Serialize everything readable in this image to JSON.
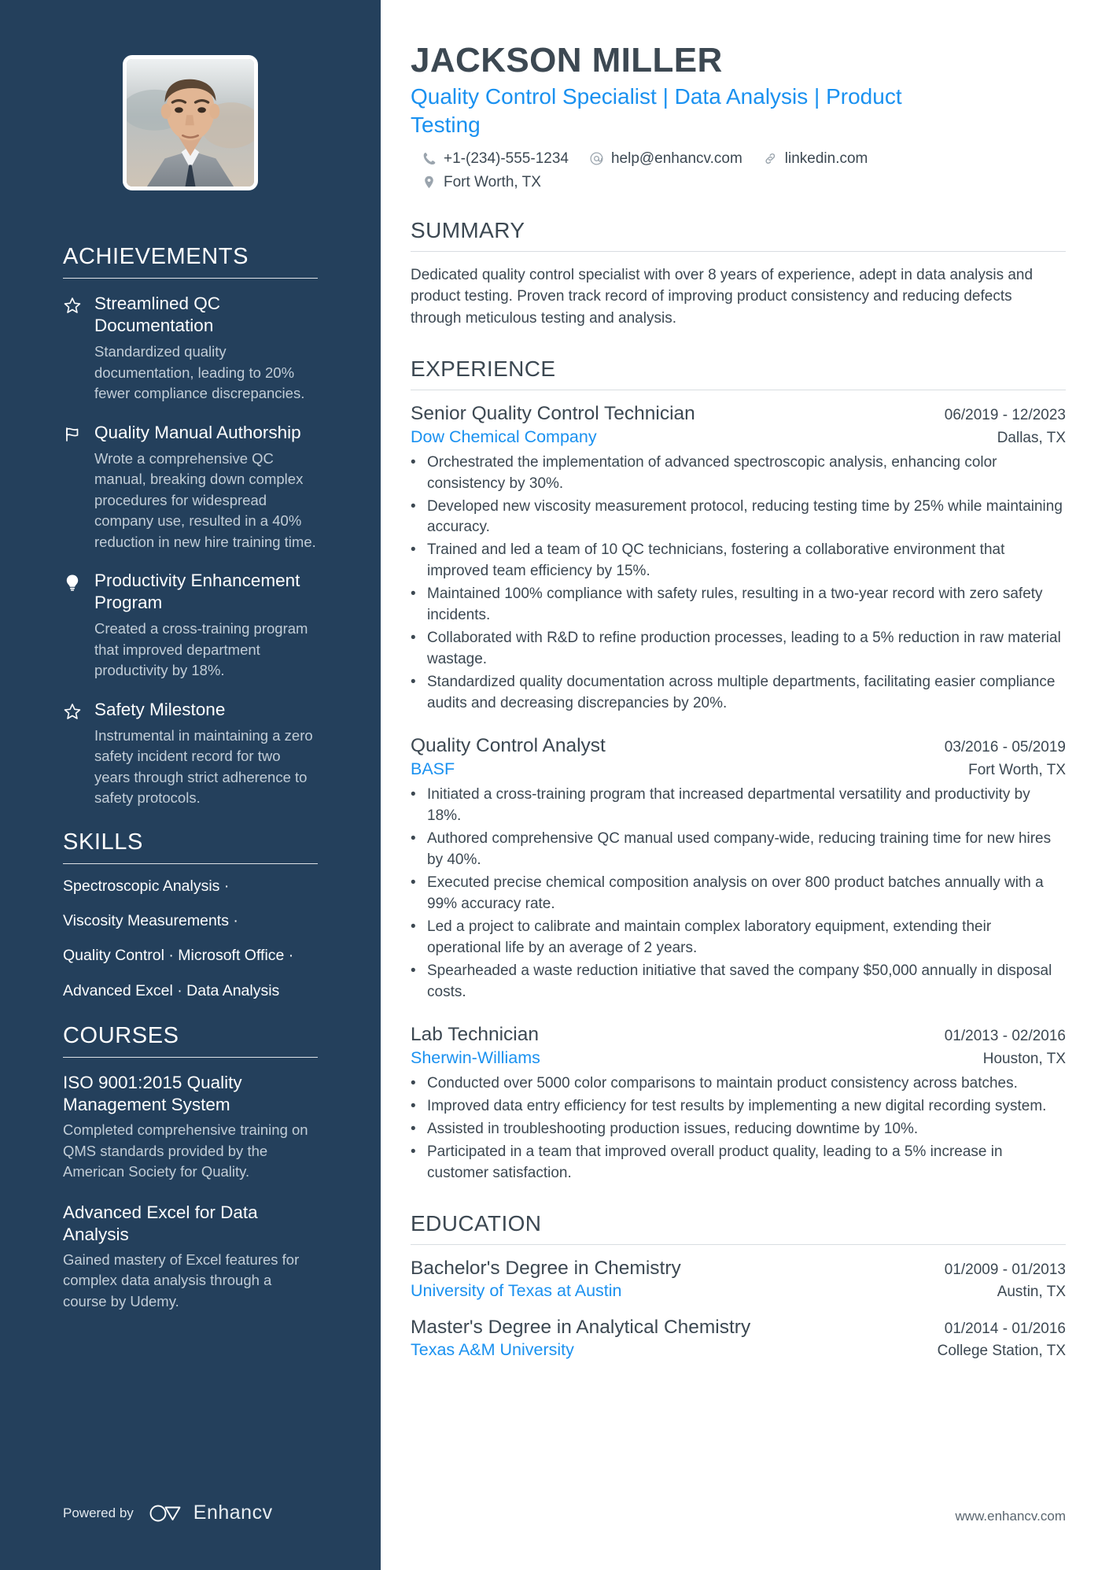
{
  "header": {
    "name": "JACKSON MILLER",
    "headline": "Quality Control Specialist | Data Analysis | Product Testing",
    "contacts": [
      {
        "icon": "phone-icon",
        "text": "+1-(234)-555-1234"
      },
      {
        "icon": "email-icon",
        "text": "help@enhancv.com"
      },
      {
        "icon": "link-icon",
        "text": "linkedin.com"
      },
      {
        "icon": "location-icon",
        "text": "Fort Worth, TX"
      }
    ]
  },
  "sidebar": {
    "achievements": {
      "title": "ACHIEVEMENTS",
      "items": [
        {
          "icon": "star-icon",
          "title": "Streamlined QC Documentation",
          "desc": "Standardized quality documentation, leading to 20% fewer compliance discrepancies."
        },
        {
          "icon": "flag-icon",
          "title": "Quality Manual Authorship",
          "desc": "Wrote a comprehensive QC manual, breaking down complex procedures for widespread company use, resulted in a 40% reduction in new hire training time."
        },
        {
          "icon": "lightbulb-icon",
          "title": "Productivity Enhancement Program",
          "desc": "Created a cross-training program that improved department productivity by 18%."
        },
        {
          "icon": "star-icon",
          "title": "Safety Milestone",
          "desc": "Instrumental in maintaining a zero safety incident record for two years through strict adherence to safety protocols."
        }
      ]
    },
    "skills": {
      "title": "SKILLS",
      "lines": [
        "Spectroscopic Analysis ·",
        "Viscosity Measurements ·",
        "Quality Control · Microsoft Office ·",
        "Advanced Excel · Data Analysis"
      ]
    },
    "courses": {
      "title": "COURSES",
      "items": [
        {
          "title": "ISO 9001:2015 Quality Management System",
          "desc": "Completed comprehensive training on QMS standards provided by the American Society for Quality."
        },
        {
          "title": "Advanced Excel for Data Analysis",
          "desc": "Gained mastery of Excel features for complex data analysis through a course by Udemy."
        }
      ]
    },
    "footer": {
      "powered_by": "Powered by",
      "brand": "Enhancv"
    }
  },
  "main": {
    "summary": {
      "title": "SUMMARY",
      "text": "Dedicated quality control specialist with over 8 years of experience, adept in data analysis and product testing. Proven track record of improving product consistency and reducing defects through meticulous testing and analysis."
    },
    "experience": {
      "title": "EXPERIENCE",
      "jobs": [
        {
          "title": "Senior Quality Control Technician",
          "date": "06/2019 - 12/2023",
          "company": "Dow Chemical Company",
          "location": "Dallas, TX",
          "bullets": [
            "Orchestrated the implementation of advanced spectroscopic analysis, enhancing color consistency by 30%.",
            "Developed new viscosity measurement protocol, reducing testing time by 25% while maintaining accuracy.",
            "Trained and led a team of 10 QC technicians, fostering a collaborative environment that improved team efficiency by 15%.",
            "Maintained 100% compliance with safety rules, resulting in a two-year record with zero safety incidents.",
            "Collaborated with R&D to refine production processes, leading to a 5% reduction in raw material wastage.",
            "Standardized quality documentation across multiple departments, facilitating easier compliance audits and decreasing discrepancies by 20%."
          ]
        },
        {
          "title": "Quality Control Analyst",
          "date": "03/2016 - 05/2019",
          "company": "BASF",
          "location": "Fort Worth, TX",
          "bullets": [
            "Initiated a cross-training program that increased departmental versatility and productivity by 18%.",
            "Authored comprehensive QC manual used company-wide, reducing training time for new hires by 40%.",
            "Executed precise chemical composition analysis on over 800 product batches annually with a 99% accuracy rate.",
            "Led a project to calibrate and maintain complex laboratory equipment, extending their operational life by an average of 2 years.",
            "Spearheaded a waste reduction initiative that saved the company $50,000 annually in disposal costs."
          ]
        },
        {
          "title": "Lab Technician",
          "date": "01/2013 - 02/2016",
          "company": "Sherwin-Williams",
          "location": "Houston, TX",
          "bullets": [
            "Conducted over 5000 color comparisons to maintain product consistency across batches.",
            "Improved data entry efficiency for test results by implementing a new digital recording system.",
            "Assisted in troubleshooting production issues, reducing downtime by 10%.",
            "Participated in a team that improved overall product quality, leading to a 5% increase in customer satisfaction."
          ]
        }
      ]
    },
    "education": {
      "title": "EDUCATION",
      "items": [
        {
          "degree": "Bachelor's Degree in Chemistry",
          "date": "01/2009 - 01/2013",
          "school": "University of Texas at Austin",
          "location": "Austin, TX"
        },
        {
          "degree": "Master's Degree in Analytical Chemistry",
          "date": "01/2014 - 01/2016",
          "school": "Texas A&M University",
          "location": "College Station, TX"
        }
      ]
    },
    "site_url": "www.enhancv.com"
  },
  "colors": {
    "sidebar_bg": "#24405c",
    "accent_blue": "#1a91f0",
    "text_dark": "#3c4852",
    "muted": "#c2cdd7"
  }
}
